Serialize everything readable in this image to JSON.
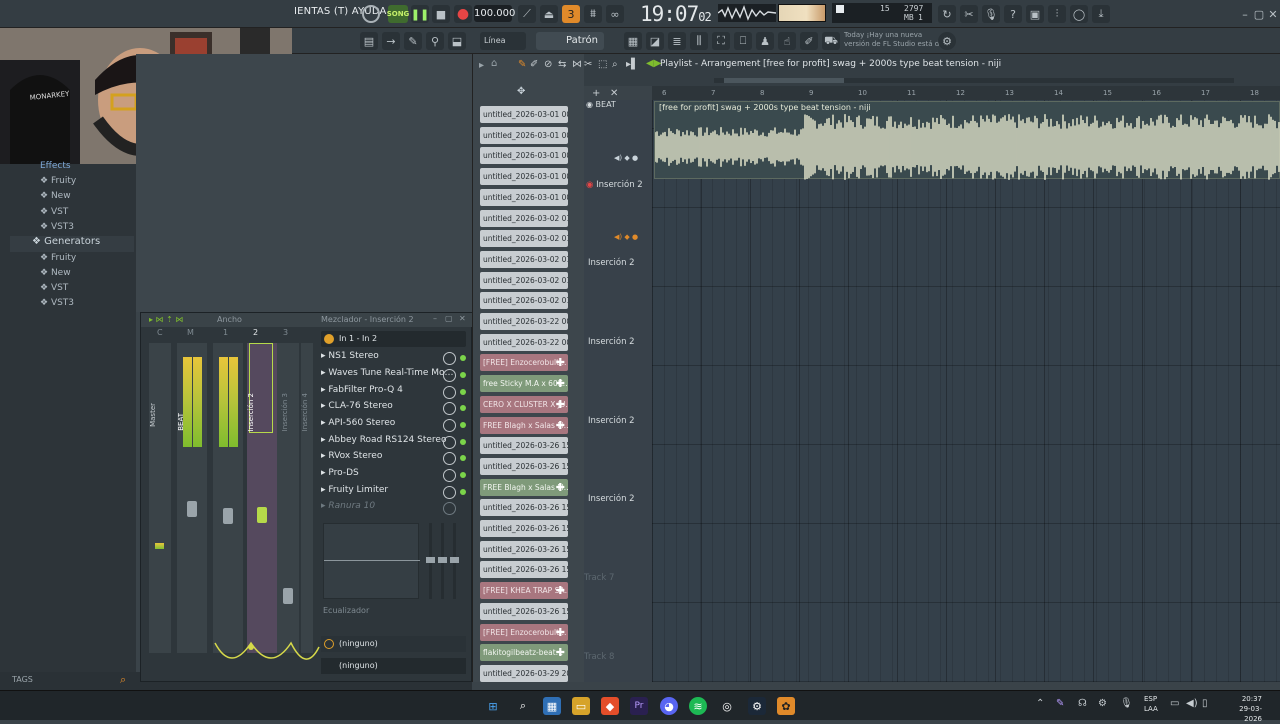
{
  "menu": {
    "text": "IENTAS (T) AYUDA"
  },
  "transport": {
    "song_label": "SONG",
    "tempo": "100.000",
    "time": "19:07",
    "time_sub": "02"
  },
  "cpu": {
    "val1": "15",
    "mem": "2797 MB",
    "val2": "1"
  },
  "toolbar2": {
    "snap": "Línea",
    "pattern": "Patrón 1",
    "hint_line1": "Today ¡Hay una nueva",
    "hint_line2": "versión de FL Studio está d…"
  },
  "browser": {
    "items": [
      "Effects",
      "Fruity",
      "New",
      "VST",
      "VST3",
      "Generators",
      "Fruity",
      "New",
      "VST",
      "VST3"
    ],
    "tags": "TAGS"
  },
  "mixer": {
    "header_left": "Ancho",
    "header_title": "Mezclador - Inserción 2",
    "routing": "In 1 - In 2",
    "strips": [
      {
        "label": "Master"
      },
      {
        "label": "BEAT"
      },
      {
        "label": "Inserción 2"
      },
      {
        "label": "Inserción 3"
      },
      {
        "label": "Inserción 4"
      }
    ],
    "strip_top": [
      "C",
      "M",
      "1",
      "2",
      "3"
    ],
    "fx": [
      "NS1 Stereo",
      "Waves Tune Real-Time Mo…",
      "FabFilter Pro-Q 4",
      "CLA-76 Stereo",
      "API-560 Stereo",
      "Abbey Road RS124 Stereo",
      "RVox Stereo",
      "Pro-DS",
      "Fruity Limiter",
      "Ranura 10"
    ],
    "eq_label": "Ecualizador",
    "send1": "(ninguno)",
    "send2": "(ninguno)"
  },
  "picker": {
    "clips": [
      {
        "label": "untitled_2026-03-01 00-…",
        "style": "grey"
      },
      {
        "label": "untitled_2026-03-01 00-…",
        "style": "grey"
      },
      {
        "label": "untitled_2026-03-01 00-…",
        "style": "grey"
      },
      {
        "label": "untitled_2026-03-01 00-…",
        "style": "grey"
      },
      {
        "label": "untitled_2026-03-01 00-…",
        "style": "grey"
      },
      {
        "label": "untitled_2026-03-02 01-…",
        "style": "grey"
      },
      {
        "label": "untitled_2026-03-02 01-…",
        "style": "grey"
      },
      {
        "label": "untitled_2026-03-02 01-…",
        "style": "grey"
      },
      {
        "label": "untitled_2026-03-02 01-…",
        "style": "grey"
      },
      {
        "label": "untitled_2026-03-02 01-…",
        "style": "grey"
      },
      {
        "label": "untitled_2026-03-22 00-…",
        "style": "grey"
      },
      {
        "label": "untitled_2026-03-22 00-…",
        "style": "grey"
      },
      {
        "label": "[FREE] Enzocerobult…",
        "style": "pink"
      },
      {
        "label": "free Sticky M.A x 60K…",
        "style": "green"
      },
      {
        "label": "CERO X CLUSTER X JU…",
        "style": "pink"
      },
      {
        "label": "FREE Blagh x Salas Fl…",
        "style": "pink"
      },
      {
        "label": "untitled_2026-03-26 15-…",
        "style": "grey"
      },
      {
        "label": "untitled_2026-03-26 15-…",
        "style": "grey"
      },
      {
        "label": "FREE Blagh x Salas Fl…",
        "style": "green"
      },
      {
        "label": "untitled_2026-03-26 15-…",
        "style": "grey"
      },
      {
        "label": "untitled_2026-03-26 15-…",
        "style": "grey"
      },
      {
        "label": "untitled_2026-03-26 15-…",
        "style": "grey"
      },
      {
        "label": "untitled_2026-03-26 15-…",
        "style": "grey"
      },
      {
        "label": "[FREE] KHEA TRAP SA…",
        "style": "pink"
      },
      {
        "label": "untitled_2026-03-26 15-…",
        "style": "grey"
      },
      {
        "label": "[FREE] Enzocerobult…",
        "style": "pink"
      },
      {
        "label": "flakitogilbeatz-beat…",
        "style": "green"
      },
      {
        "label": "untitled_2026-03-29 20-…",
        "style": "grey"
      }
    ]
  },
  "playlist": {
    "breadcrumb": "Playlist - Arrangement",
    "sep": "›",
    "current": "[free for profit] swag + 2000s type beat tension - niji",
    "ruler": [
      "6",
      "7",
      "8",
      "9",
      "10",
      "11",
      "12",
      "13",
      "14",
      "15",
      "16",
      "17",
      "18"
    ],
    "tracks": [
      "BEAT",
      "Inserción 2",
      "Inserción 2",
      "Inserción 2",
      "Inserción 2",
      "Inserción 2",
      "Track 7",
      "Track 8"
    ],
    "clip_title": "[free for profit] swag + 2000s type beat tension - niji"
  },
  "taskbar": {
    "lang1": "ESP",
    "lang2": "LAA",
    "time": "20:37",
    "date": "29-03-2026"
  }
}
